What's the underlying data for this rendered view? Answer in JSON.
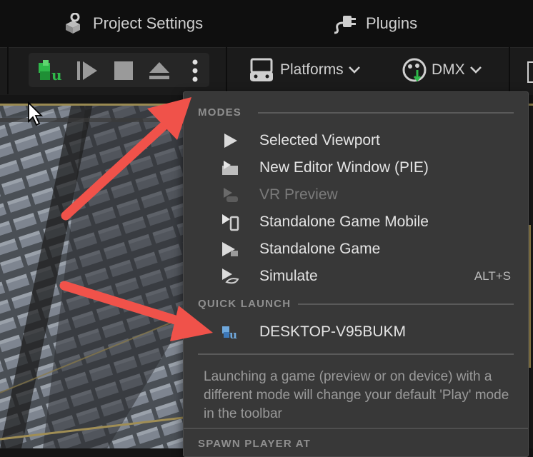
{
  "top_bar": {
    "project_settings_label": "Project Settings",
    "plugins_label": "Plugins"
  },
  "toolbar": {
    "platforms_label": "Platforms",
    "dmx_label": "DMX"
  },
  "play_menu": {
    "modes_header": "MODES",
    "modes": [
      {
        "label": "Selected Viewport",
        "icon": "play-viewport-icon",
        "enabled": true,
        "shortcut": ""
      },
      {
        "label": "New Editor Window (PIE)",
        "icon": "new-window-icon",
        "enabled": true,
        "shortcut": ""
      },
      {
        "label": "VR Preview",
        "icon": "vr-icon",
        "enabled": false,
        "shortcut": ""
      },
      {
        "label": "Standalone Game Mobile",
        "icon": "mobile-icon",
        "enabled": true,
        "shortcut": ""
      },
      {
        "label": "Standalone Game",
        "icon": "standalone-icon",
        "enabled": true,
        "shortcut": ""
      },
      {
        "label": "Simulate",
        "icon": "simulate-icon",
        "enabled": true,
        "shortcut": "ALT+S"
      }
    ],
    "quick_launch_header": "QUICK LAUNCH",
    "quick_launch_device": "DESKTOP-V95BUKM",
    "description": "Launching a game (preview or on device) with a different mode will change your default 'Play' mode in the toolbar",
    "spawn_header": "SPAWN PLAYER AT"
  },
  "colors": {
    "menu_bg": "#383838",
    "accent_green": "#2fb84a",
    "annotation_arrow": "#f0524a"
  }
}
